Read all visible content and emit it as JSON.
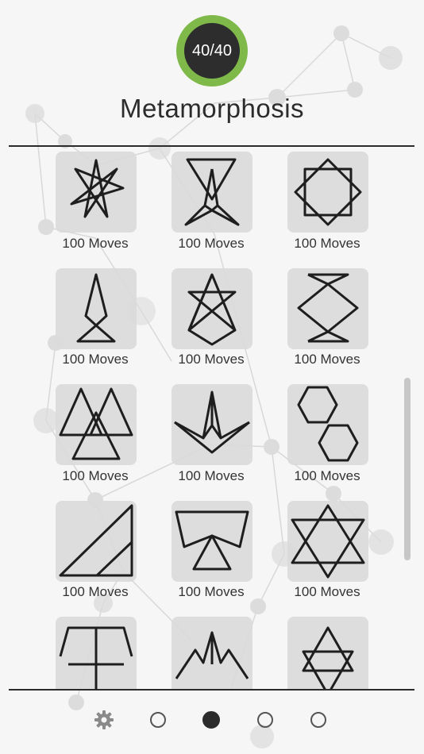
{
  "header": {
    "progress_text": "40/40",
    "progress_fraction": 1.0,
    "title": "Metamorphosis"
  },
  "levels": [
    {
      "label": "100 Moves",
      "icon": "seven-point-star-icon"
    },
    {
      "label": "100 Moves",
      "icon": "hourglass-triangles-icon"
    },
    {
      "label": "100 Moves",
      "icon": "eight-point-star-icon"
    },
    {
      "label": "100 Moves",
      "icon": "kite-figure-icon"
    },
    {
      "label": "100 Moves",
      "icon": "unicursal-hexagram-icon"
    },
    {
      "label": "100 Moves",
      "icon": "diamond-hourglass-icon"
    },
    {
      "label": "100 Moves",
      "icon": "three-triangles-icon"
    },
    {
      "label": "100 Moves",
      "icon": "folded-pyramid-icon"
    },
    {
      "label": "100 Moves",
      "icon": "two-hexagons-icon"
    },
    {
      "label": "100 Moves",
      "icon": "right-triangles-icon"
    },
    {
      "label": "100 Moves",
      "icon": "bowtie-icon"
    },
    {
      "label": "100 Moves",
      "icon": "star-of-lakshmi-icon"
    },
    {
      "label": "",
      "icon": "trident-icon"
    },
    {
      "label": "",
      "icon": "crown-arrow-icon"
    },
    {
      "label": "",
      "icon": "hexagram-icon"
    }
  ],
  "pager": {
    "settings_icon": "gear-icon",
    "page_count": 4,
    "active_page": 2
  },
  "colors": {
    "accent": "#7eb949",
    "badge": "#2d2d2d",
    "text": "#2c2c2c"
  }
}
